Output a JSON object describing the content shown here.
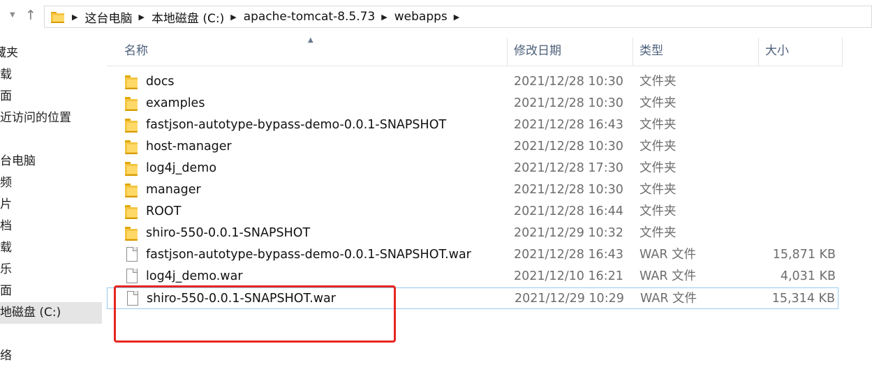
{
  "address": {
    "crumbs": [
      "这台电脑",
      "本地磁盘 (C:)",
      "apache-tomcat-8.5.73",
      "webapps"
    ]
  },
  "sidebar": {
    "items": [
      {
        "label": "藏夹",
        "selected": false
      },
      {
        "label": "载",
        "selected": false
      },
      {
        "label": "面",
        "selected": false
      },
      {
        "label": "近访问的位置",
        "selected": false
      },
      {
        "label": "台电脑",
        "selected": false
      },
      {
        "label": "频",
        "selected": false
      },
      {
        "label": "片",
        "selected": false
      },
      {
        "label": "档",
        "selected": false
      },
      {
        "label": "载",
        "selected": false
      },
      {
        "label": "乐",
        "selected": false
      },
      {
        "label": "面",
        "selected": false
      },
      {
        "label": "地磁盘 (C:)",
        "selected": true
      },
      {
        "label": "络",
        "selected": false
      }
    ]
  },
  "columns": {
    "name": "名称",
    "date": "修改日期",
    "type": "类型",
    "size": "大小"
  },
  "files": [
    {
      "name": "docs",
      "date": "2021/12/28 10:30",
      "type": "文件夹",
      "size": "",
      "icon": "folder-icon"
    },
    {
      "name": "examples",
      "date": "2021/12/28 10:30",
      "type": "文件夹",
      "size": "",
      "icon": "folder-icon"
    },
    {
      "name": "fastjson-autotype-bypass-demo-0.0.1-SNAPSHOT",
      "date": "2021/12/28 16:43",
      "type": "文件夹",
      "size": "",
      "icon": "folder-icon"
    },
    {
      "name": "host-manager",
      "date": "2021/12/28 10:30",
      "type": "文件夹",
      "size": "",
      "icon": "folder-icon"
    },
    {
      "name": "log4j_demo",
      "date": "2021/12/28 17:30",
      "type": "文件夹",
      "size": "",
      "icon": "folder-icon"
    },
    {
      "name": "manager",
      "date": "2021/12/28 10:30",
      "type": "文件夹",
      "size": "",
      "icon": "folder-icon"
    },
    {
      "name": "ROOT",
      "date": "2021/12/28 16:44",
      "type": "文件夹",
      "size": "",
      "icon": "folder-icon"
    },
    {
      "name": "shiro-550-0.0.1-SNAPSHOT",
      "date": "2021/12/29 10:32",
      "type": "文件夹",
      "size": "",
      "icon": "folder-icon"
    },
    {
      "name": "fastjson-autotype-bypass-demo-0.0.1-SNAPSHOT.war",
      "date": "2021/12/28 16:43",
      "type": "WAR 文件",
      "size": "15,871 KB",
      "icon": "file-icon"
    },
    {
      "name": "log4j_demo.war",
      "date": "2021/12/10 16:21",
      "type": "WAR 文件",
      "size": "4,031 KB",
      "icon": "file-icon"
    },
    {
      "name": "shiro-550-0.0.1-SNAPSHOT.war",
      "date": "2021/12/29 10:29",
      "type": "WAR 文件",
      "size": "15,314 KB",
      "icon": "file-icon",
      "selected": true
    }
  ],
  "colors": {
    "selection_border": "#99c9ef",
    "annotation_red": "#e8251f",
    "folder_yellow": "#f4c542"
  }
}
